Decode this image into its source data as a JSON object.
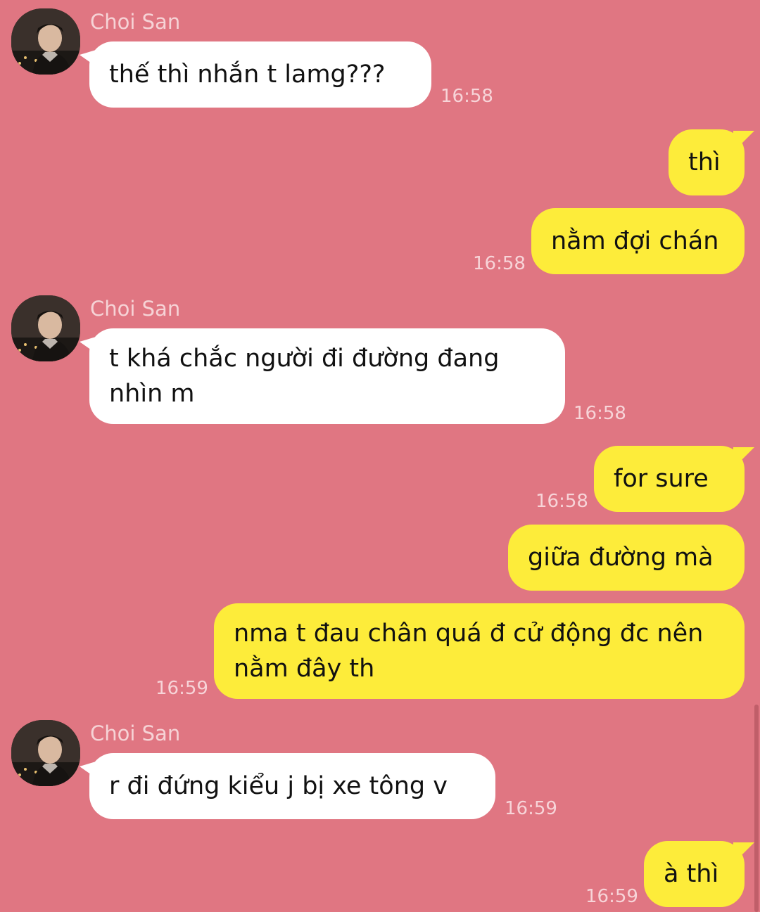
{
  "messages": [
    {
      "sender": "Choi San",
      "text": "thế thì nhắn t lamg???",
      "time": "16:58"
    },
    {
      "text": "thì"
    },
    {
      "text": "nằm đợi chán",
      "time": "16:58"
    },
    {
      "sender": "Choi San",
      "text": "t khá chắc người đi đường đang\nnhìn m",
      "time": "16:58"
    },
    {
      "text": "for sure",
      "time": "16:58"
    },
    {
      "text": "giữa đường mà"
    },
    {
      "text": "nma t đau chân quá đ cử động đc nên\nnằm đây th",
      "time": "16:59"
    },
    {
      "sender": "Choi San",
      "text": "r đi đứng kiểu j bị xe tông v",
      "time": "16:59"
    },
    {
      "text": "à thì",
      "time": "16:59"
    }
  ],
  "colors": {
    "background": "#e07682",
    "incoming_bubble": "#ffffff",
    "outgoing_bubble": "#fdec3a",
    "timestamp": "#f7d4d8"
  }
}
